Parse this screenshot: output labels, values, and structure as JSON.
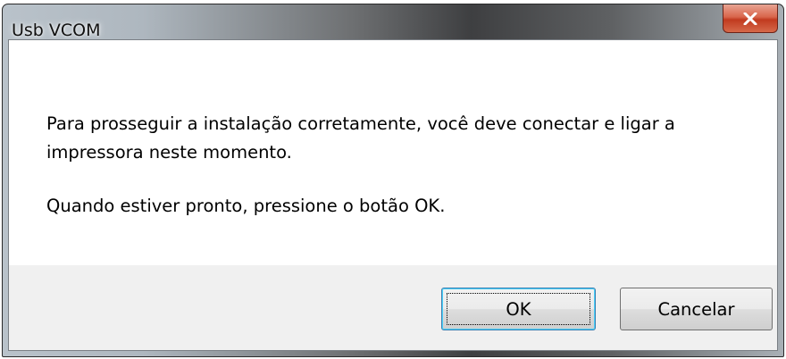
{
  "window": {
    "title": "Usb VCOM",
    "close_icon": "close-icon"
  },
  "message": {
    "line1": "Para prosseguir a instalação corretamente, você deve conectar e ligar a",
    "line2": "impressora neste momento.",
    "line3": "Quando estiver pronto, pressione o botão OK."
  },
  "buttons": {
    "ok_label": "OK",
    "cancel_label": "Cancelar"
  },
  "colors": {
    "close_button": "#c94a2c",
    "focus_border": "#3c7fb1"
  }
}
